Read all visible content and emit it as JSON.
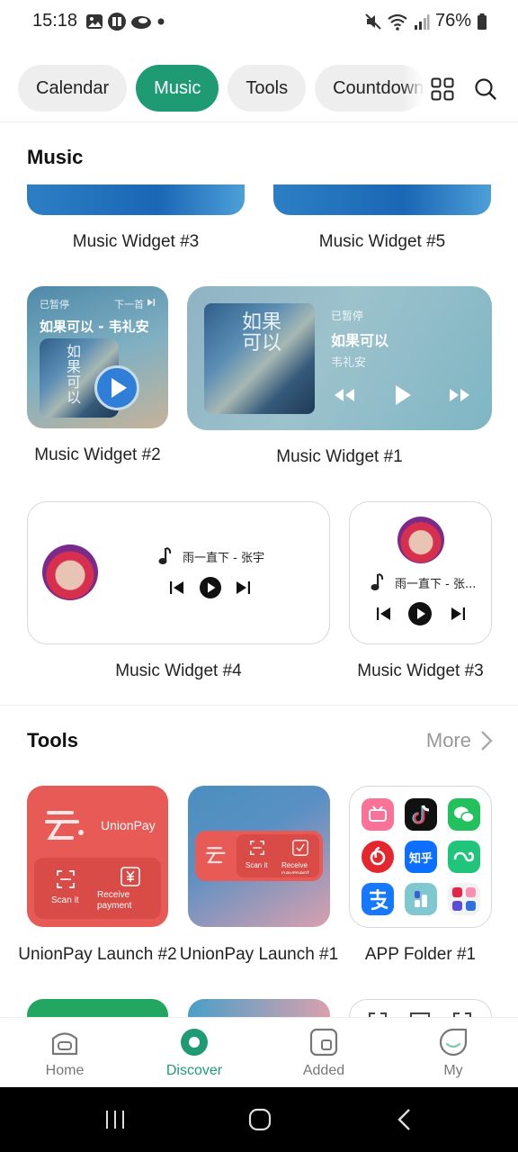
{
  "status_bar": {
    "time": "15:18",
    "battery": "76%"
  },
  "tabs": [
    "Calendar",
    "Music",
    "Tools",
    "Countdown"
  ],
  "active_tab": "Music",
  "music_section": {
    "title": "Music",
    "row1": [
      "Music Widget #3",
      "Music Widget #5"
    ],
    "widget2": {
      "label": "Music Widget #2",
      "paused": "已暂停",
      "next": "下一首",
      "song": "如果可以 - 韦礼安",
      "art_text": "如果可以"
    },
    "widget1": {
      "label": "Music Widget #1",
      "paused": "已暂停",
      "song": "如果可以",
      "artist": "韦礼安",
      "art_text": "如果可以"
    },
    "widget4": {
      "label": "Music Widget #4",
      "track": "雨一直下 - 张宇"
    },
    "widget3b": {
      "label": "Music Widget #3",
      "track": "雨一直下 - 张..."
    }
  },
  "tools_section": {
    "title": "Tools",
    "more": "More",
    "unionpay2": {
      "label": "UnionPay Launch #2",
      "brand": "UnionPay",
      "scan": "Scan it",
      "receive": "Receive payment"
    },
    "unionpay1": {
      "label": "UnionPay Launch #1",
      "scan": "Scan it",
      "receive": "Receive payment"
    },
    "folder": {
      "label": "APP Folder #1",
      "apps": [
        "bilibili",
        "douyin",
        "wechat",
        "netease-music",
        "zhihu",
        "app-cloud",
        "alipay",
        "app-dots",
        "mini-grid"
      ],
      "zhihu_text": "知乎"
    }
  },
  "bottom_nav": {
    "items": [
      "Home",
      "Discover",
      "Added",
      "My"
    ],
    "active": "Discover"
  },
  "colors": {
    "accent": "#1f9b74",
    "union_red": "#e85a55"
  }
}
